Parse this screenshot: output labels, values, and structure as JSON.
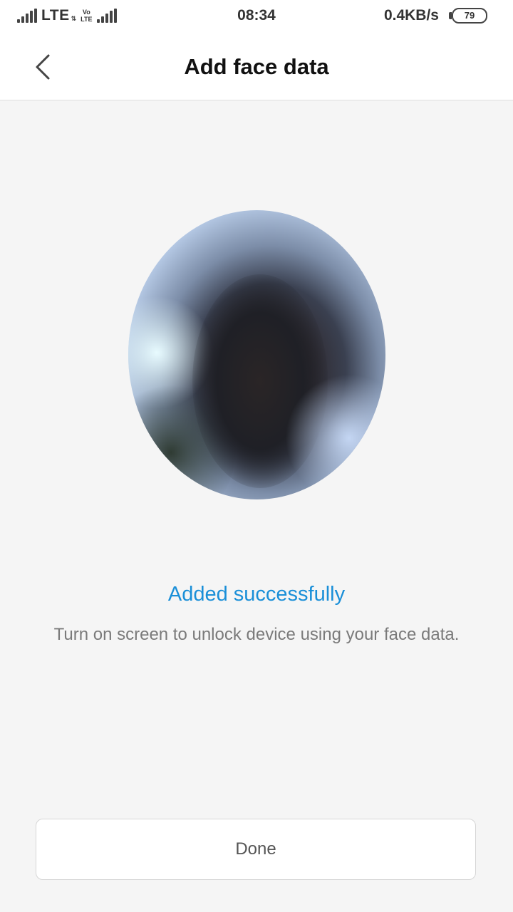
{
  "status_bar": {
    "network1": "LTE",
    "volte_top": "Vo",
    "volte_bottom": "LTE",
    "time": "08:34",
    "speed": "0.4KB/s",
    "battery": "79"
  },
  "header": {
    "back_icon": "chevron-left-icon",
    "title": "Add face data"
  },
  "main": {
    "status_message": "Added successfully",
    "description": "Turn on screen to unlock device using your face data."
  },
  "footer": {
    "done_label": "Done"
  },
  "colors": {
    "accent": "#1a8fd8",
    "background": "#f5f5f5"
  }
}
